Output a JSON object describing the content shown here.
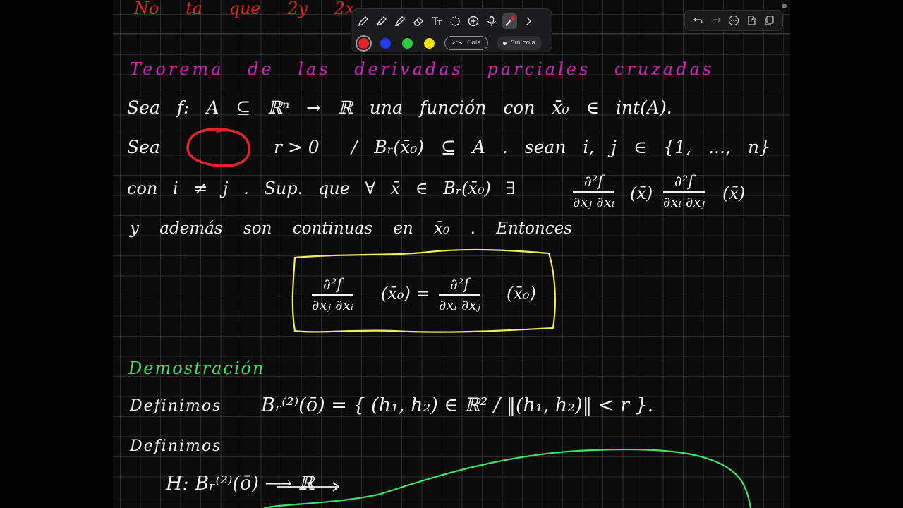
{
  "notes": {
    "top_partial": "No ta  que   2y 2x",
    "theorem_title": "Teorema de las derivadas parciales cruzadas",
    "line1": "Sea  f: A ⊆ ℝⁿ → ℝ  una función  con  x̄₀ ∈ int(A).",
    "line2_a": "Sea",
    "line2_b": "r > 0",
    "line2_c": "/  Bᵣ(x̄₀) ⊆ A .  sean  i, j ∈ {1, ..., n}",
    "line3_a": "con  i ≠ j .  Sup. que   ∀ x̄ ∈ Bᵣ(x̄₀)   ∃",
    "line3_frac1_num": "∂²f",
    "line3_frac1_den": "∂xⱼ ∂xᵢ",
    "line3_p1": "(x̄)",
    "line3_frac2_num": "∂²f",
    "line3_frac2_den": "∂xᵢ ∂xⱼ",
    "line3_p2": "(x̄)",
    "line4": "y  además  son  continuas  en  x̄₀ .  Entonces",
    "boxed_frac1_num": "∂²f",
    "boxed_frac1_den": "∂xⱼ ∂xᵢ",
    "boxed_p1": "(x̄₀)  =",
    "boxed_frac2_num": "∂²f",
    "boxed_frac2_den": "∂xᵢ ∂xⱼ",
    "boxed_p2": "(x̄₀)",
    "demo_title": "Demostración",
    "def1_label": "Definimos",
    "def1_expr": "Bᵣ⁽²⁾(ō) = { (h₁, h₂) ∈ ℝ² /  ‖(h₁, h₂)‖ < r }.",
    "def2_label": "Definimos",
    "h_line": "H:  Bᵣ⁽²⁾(ō) ⟶ ℝ"
  },
  "toolbar": {
    "tools": [
      "pen-icon",
      "fountain-pen-icon",
      "highlighter-icon",
      "eraser-icon",
      "text-icon",
      "lasso-icon",
      "shape-plus-icon",
      "microphone-icon",
      "laser-pointer-icon",
      "chevron-right-icon"
    ],
    "colors": [
      "#e0262a",
      "#1f3cf0",
      "#2ecc40",
      "#f5e10a"
    ],
    "tail_label": "Cola",
    "no_tail_label": "Sin cola"
  },
  "ink_colors": {
    "white": "#f2f2f2",
    "magenta": "#d026c0",
    "green": "#3fe06a",
    "yellow": "#f0ec5a",
    "red": "#e0262a"
  }
}
